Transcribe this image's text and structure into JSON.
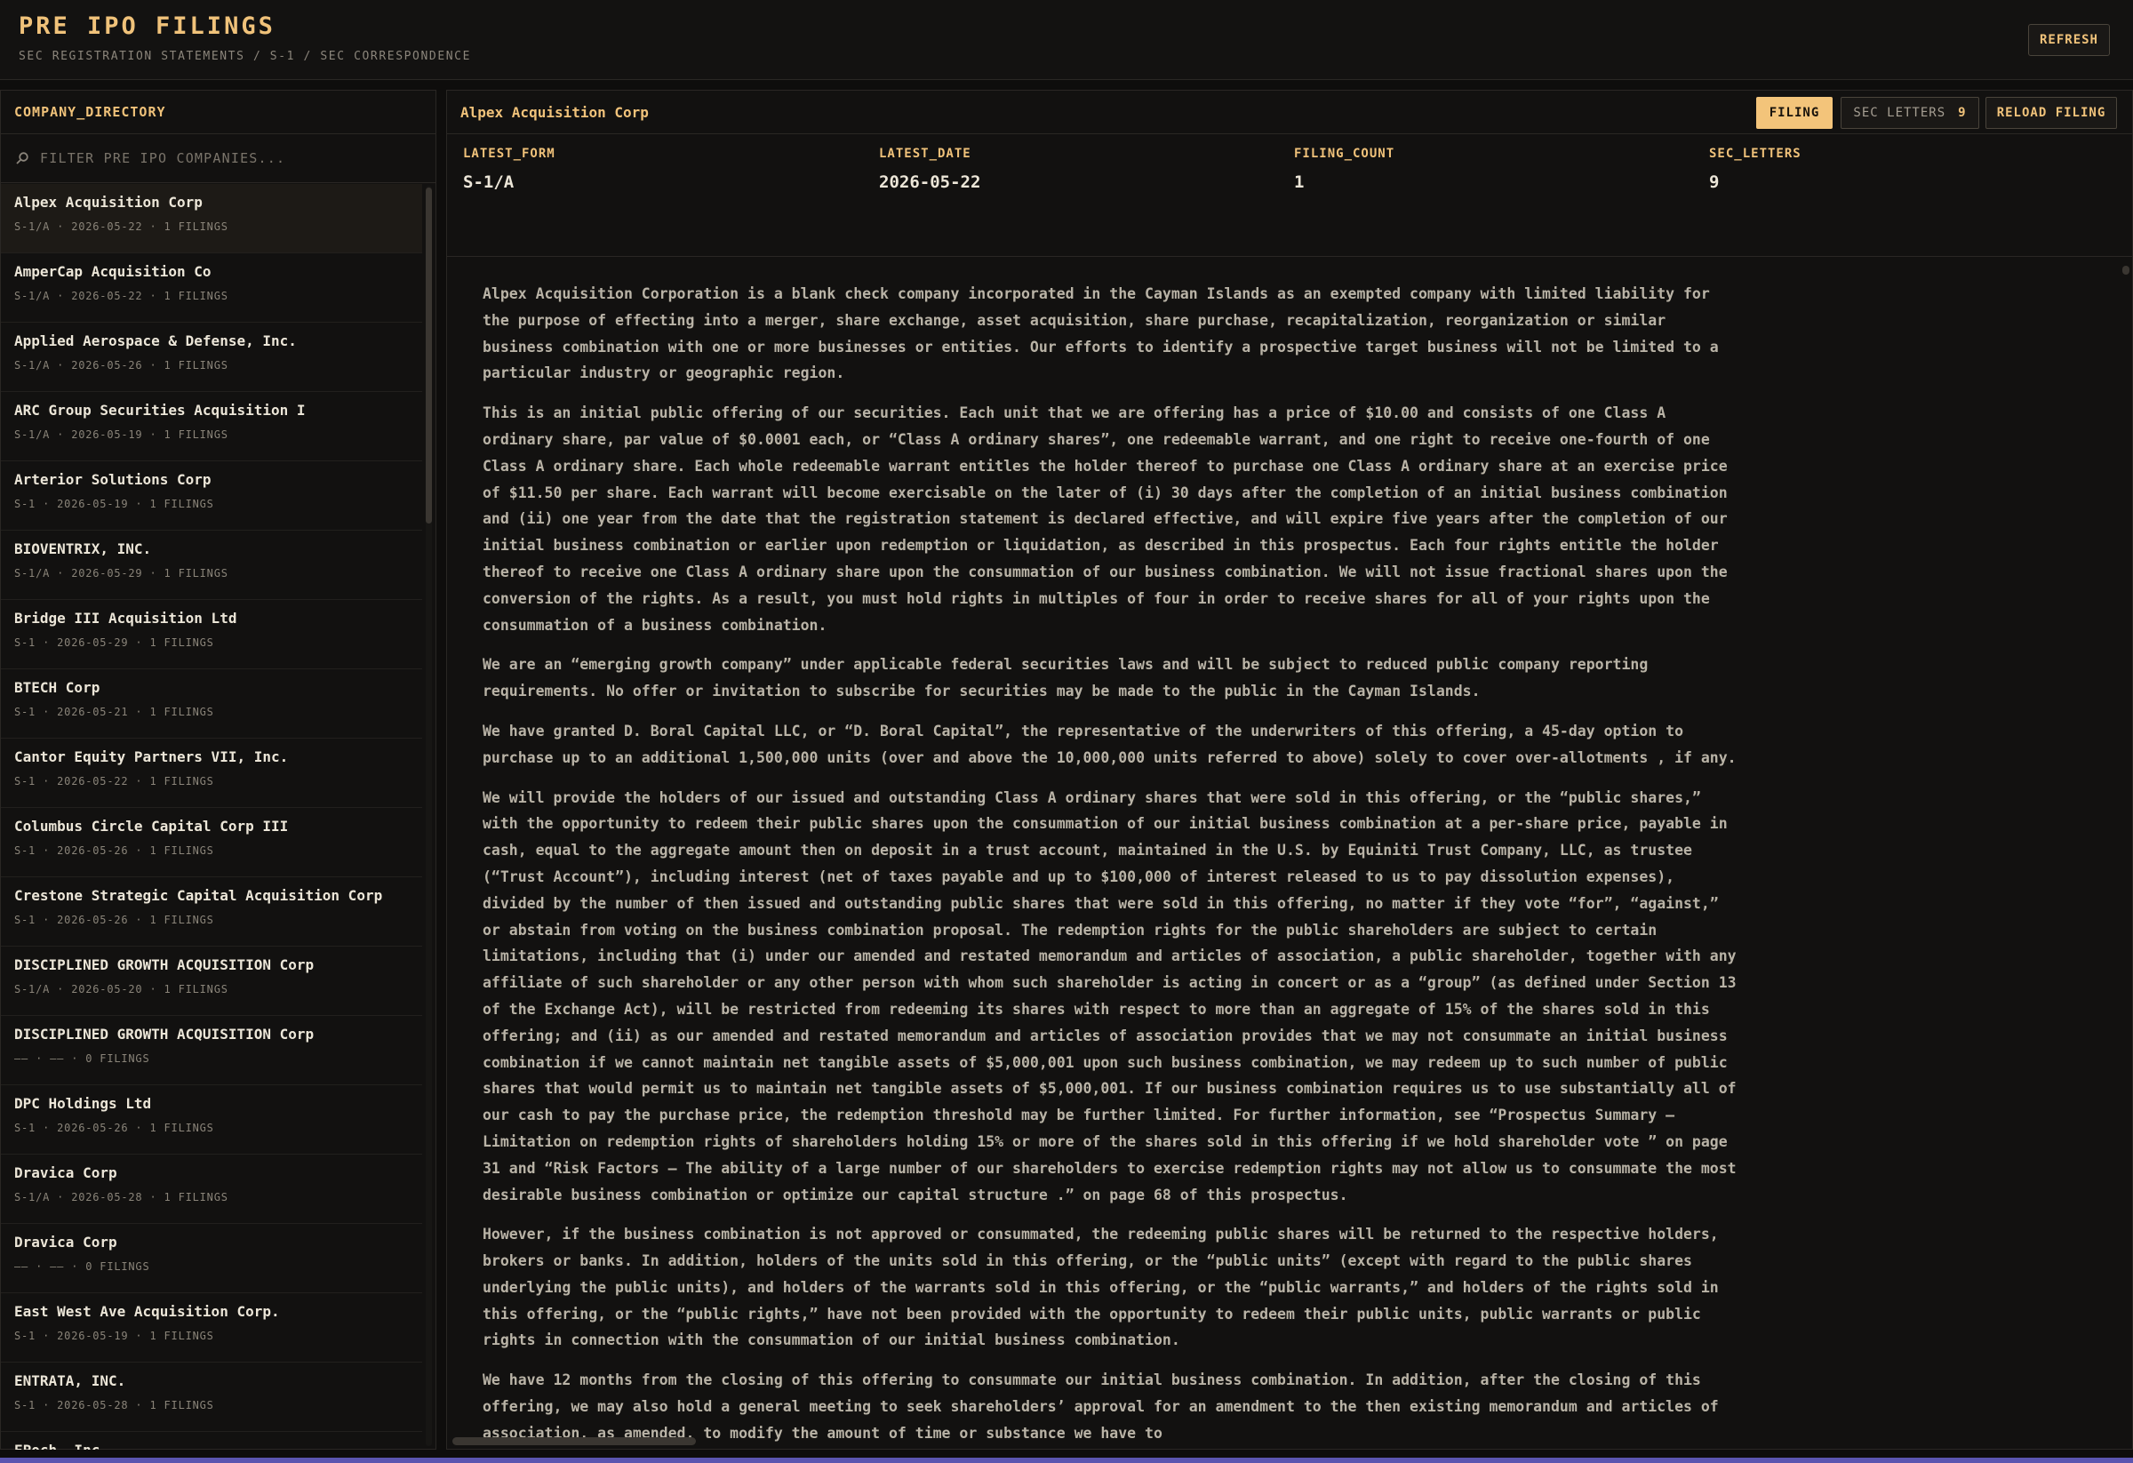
{
  "header": {
    "title": "PRE IPO FILINGS",
    "subtitle": "SEC REGISTRATION STATEMENTS / S-1 / SEC CORRESPONDENCE",
    "refresh_label": "REFRESH"
  },
  "sidebar": {
    "title": "COMPANY_DIRECTORY",
    "filter_placeholder": "FILTER PRE IPO COMPANIES...",
    "companies": [
      {
        "name": "Alpex Acquisition Corp",
        "meta": "S-1/A · 2026-05-22 · 1 FILINGS"
      },
      {
        "name": "AmperCap Acquisition Co",
        "meta": "S-1/A · 2026-05-22 · 1 FILINGS"
      },
      {
        "name": "Applied Aerospace & Defense, Inc.",
        "meta": "S-1/A · 2026-05-26 · 1 FILINGS"
      },
      {
        "name": "ARC Group Securities Acquisition I",
        "meta": "S-1/A · 2026-05-19 · 1 FILINGS"
      },
      {
        "name": "Arterior Solutions Corp",
        "meta": "S-1 · 2026-05-19 · 1 FILINGS"
      },
      {
        "name": "BIOVENTRIX, INC.",
        "meta": "S-1/A · 2026-05-29 · 1 FILINGS"
      },
      {
        "name": "Bridge III Acquisition Ltd",
        "meta": "S-1 · 2026-05-29 · 1 FILINGS"
      },
      {
        "name": "BTECH Corp",
        "meta": "S-1 · 2026-05-21 · 1 FILINGS"
      },
      {
        "name": "Cantor Equity Partners VII, Inc.",
        "meta": "S-1 · 2026-05-22 · 1 FILINGS"
      },
      {
        "name": "Columbus Circle Capital Corp III",
        "meta": "S-1 · 2026-05-26 · 1 FILINGS"
      },
      {
        "name": "Crestone Strategic Capital Acquisition Corp",
        "meta": "S-1 · 2026-05-26 · 1 FILINGS"
      },
      {
        "name": "DISCIPLINED GROWTH ACQUISITION Corp",
        "meta": "S-1/A · 2026-05-20 · 1 FILINGS"
      },
      {
        "name": "DISCIPLINED GROWTH ACQUISITION Corp",
        "meta": "—— · —— · 0 FILINGS"
      },
      {
        "name": "DPC Holdings Ltd",
        "meta": "S-1 · 2026-05-26 · 1 FILINGS"
      },
      {
        "name": "Dravica Corp",
        "meta": "S-1/A · 2026-05-28 · 1 FILINGS"
      },
      {
        "name": "Dravica Corp",
        "meta": "—— · —— · 0 FILINGS"
      },
      {
        "name": "East West Ave Acquisition Corp.",
        "meta": "S-1 · 2026-05-19 · 1 FILINGS"
      },
      {
        "name": "ENTRATA, INC.",
        "meta": "S-1 · 2026-05-28 · 1 FILINGS"
      },
      {
        "name": "EPoch, Inc.",
        "meta": ""
      }
    ]
  },
  "main": {
    "company_title": "Alpex Acquisition Corp",
    "buttons": {
      "filing": "FILING",
      "sec_letters": "SEC LETTERS",
      "sec_letters_count": "9",
      "reload": "RELOAD FILING"
    },
    "stats": [
      {
        "label": "LATEST_FORM",
        "value": "S-1/A"
      },
      {
        "label": "LATEST_DATE",
        "value": "2026-05-22"
      },
      {
        "label": "FILING_COUNT",
        "value": "1"
      },
      {
        "label": "SEC_LETTERS",
        "value": "9"
      }
    ],
    "document_paragraphs": [
      "Alpex Acquisition Corporation is a blank check company incorporated in the Cayman Islands as an exempted company with limited liability for the purpose of effecting into a merger, share exchange, asset acquisition, share purchase, recapitalization, reorganization or similar business combination with one or more businesses or entities. Our efforts to identify a prospective target business will not be limited to a particular industry or geographic region.",
      "This is an initial public offering of our securities. Each unit that we are offering has a price of $10.00 and consists of one Class A ordinary share, par value of $0.0001 each, or “Class A ordinary shares”, one redeemable warrant, and one right to receive one-fourth of one Class A ordinary share. Each whole redeemable warrant entitles the holder thereof to purchase one Class A ordinary share at an exercise price of $11.50 per share. Each warrant will become exercisable on the later of (i) 30 days after the completion of an initial business combination and (ii) one year from the date that the registration statement is declared effective, and will expire five years after the completion of our initial business combination or earlier upon redemption or liquidation, as described in this prospectus. Each four rights entitle the holder thereof to receive one Class A ordinary share upon the consummation of our business combination. We will not issue fractional shares upon the conversion of the rights. As a result, you must hold rights in multiples of four in order to receive shares for all of your rights upon the consummation of a business combination.",
      "We are an “emerging growth company” under applicable federal securities laws and will be subject to reduced public company reporting requirements. No offer or invitation to subscribe for securities may be made to the public in the Cayman Islands.",
      "We have granted D. Boral Capital LLC, or “D. Boral Capital”, the representative of the underwriters of this offering, a 45-day option to purchase up to an additional 1,500,000 units (over and above the 10,000,000 units referred to above) solely to cover over-allotments , if any.",
      "We will provide the holders of our issued and outstanding Class A ordinary shares that were sold in this offering, or the “public shares,” with the opportunity to redeem their public shares upon the consummation of our initial business combination at a per-share price, payable in cash, equal to the aggregate amount then on deposit in a trust account, maintained in the U.S. by Equiniti Trust Company, LLC, as trustee (“Trust Account”), including interest (net of taxes payable and up to $100,000 of interest released to us to pay dissolution expenses), divided by the number of then issued and outstanding public shares that were sold in this offering, no matter if they vote “for”, “against,” or abstain from voting on the business combination proposal. The redemption rights for the public shareholders are subject to certain limitations, including that (i) under our amended and restated memorandum and articles of association, a public shareholder, together with any affiliate of such shareholder or any other person with whom such shareholder is acting in concert or as a “group” (as defined under Section 13 of the Exchange Act), will be restricted from redeeming its shares with respect to more than an aggregate of 15% of the shares sold in this offering; and (ii) as our amended and restated memorandum and articles of association provides that we may not consummate an initial business combination if we cannot maintain net tangible assets of $5,000,001 upon such business combination, we may redeem up to such number of public shares that would permit us to maintain net tangible assets of $5,000,001. If our business combination requires us to use substantially all of our cash to pay the purchase price, the redemption threshold may be further limited. For further information, see “Prospectus Summary — Limitation on redemption rights of shareholders holding 15% or more of the shares sold in this offering if we hold shareholder vote ” on page 31 and “Risk Factors — The ability of a large number of our shareholders to exercise redemption rights may not allow us to consummate the most desirable business combination or optimize our capital structure .” on page 68 of this prospectus.",
      "However, if the business combination is not approved or consummated, the redeeming public shares will be returned to the respective holders, brokers or banks. In addition, holders of the units sold in this offering, or the “public units” (except with regard to the public shares underlying the public units), and holders of the warrants sold in this offering, or the “public warrants,” and holders of the rights sold in this offering, or the “public rights,” have not been provided with the opportunity to redeem their public units, public warrants or public rights in connection with the consummation of our initial business combination.",
      "We have 12 months from the closing of this offering to consummate our initial business combination. In addition, after the closing of this offering, we may also hold a general meeting to seek shareholders’ approval for an amendment to the then existing memorandum and articles of association, as amended, to modify the amount of time or substance we have to"
    ]
  }
}
